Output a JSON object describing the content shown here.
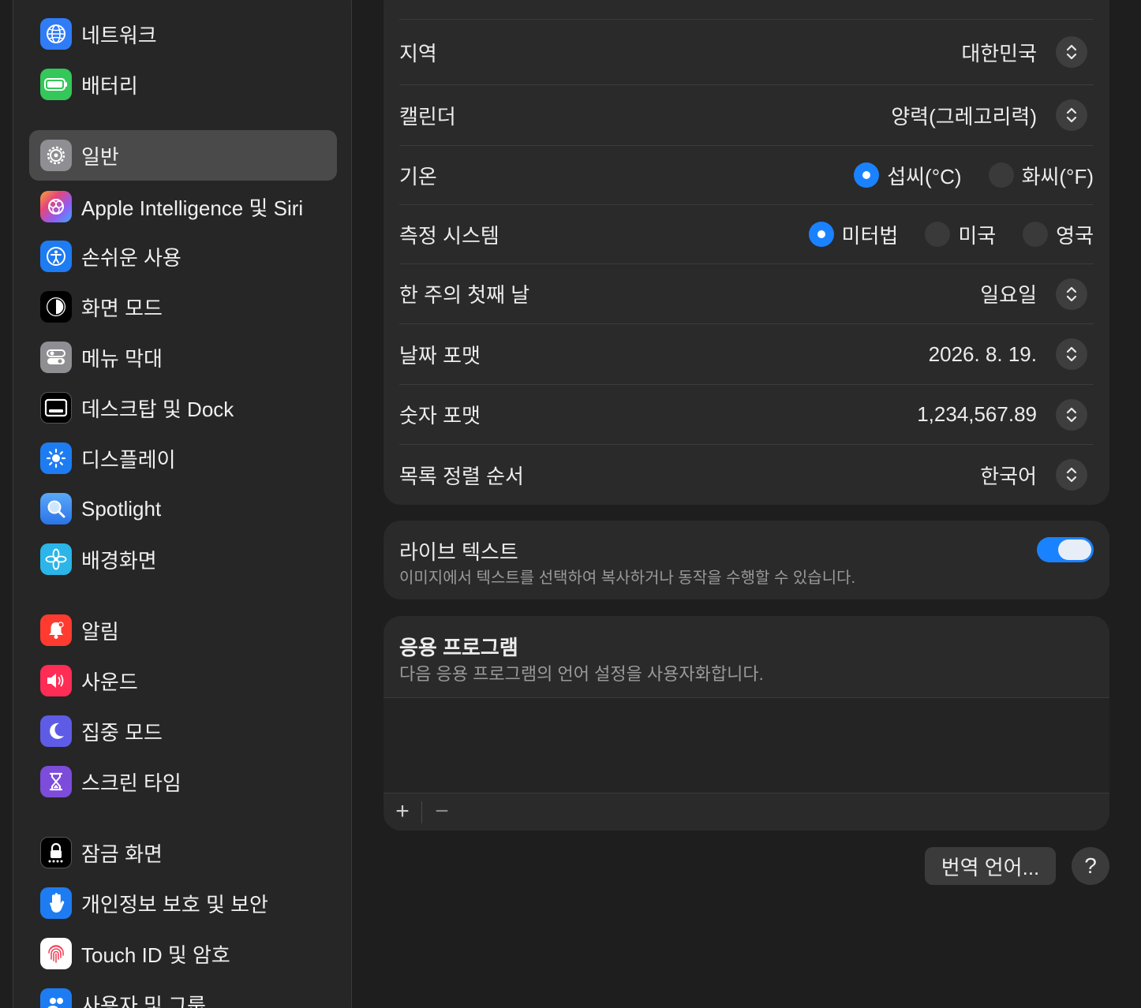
{
  "sidebar": {
    "items": [
      {
        "label": "네트워크",
        "icon": "globe-icon",
        "color": "#2f7cf6"
      },
      {
        "label": "배터리",
        "icon": "battery-icon",
        "color": "#34c759"
      },
      {
        "label": "일반",
        "icon": "gear-icon",
        "color": "#8e8e93"
      },
      {
        "label": "Apple Intelligence 및 Siri",
        "icon": "siri-icon",
        "color": "#e5467a"
      },
      {
        "label": "손쉬운 사용",
        "icon": "accessibility-icon",
        "color": "#1e7cf2"
      },
      {
        "label": "화면 모드",
        "icon": "appearance-icon",
        "color": "#000000"
      },
      {
        "label": "메뉴 막대",
        "icon": "toggles-icon",
        "color": "#8e8e93"
      },
      {
        "label": "데스크탑 및 Dock",
        "icon": "dock-icon",
        "color": "#000000"
      },
      {
        "label": "디스플레이",
        "icon": "sun-icon",
        "color": "#1e7cf2"
      },
      {
        "label": "Spotlight",
        "icon": "magnifier-icon",
        "color": "#3a8cf5"
      },
      {
        "label": "배경화면",
        "icon": "flower-icon",
        "color": "#2bb5e8"
      },
      {
        "label": "알림",
        "icon": "bell-icon",
        "color": "#ff3b30"
      },
      {
        "label": "사운드",
        "icon": "speaker-icon",
        "color": "#ff2d55"
      },
      {
        "label": "집중 모드",
        "icon": "moon-icon",
        "color": "#5e5ce6"
      },
      {
        "label": "스크린 타임",
        "icon": "hourglass-icon",
        "color": "#7d4cdb"
      },
      {
        "label": "잠금 화면",
        "icon": "lock-icon",
        "color": "#000000"
      },
      {
        "label": "개인정보 보호 및 보안",
        "icon": "hand-icon",
        "color": "#1e7cf2"
      },
      {
        "label": "Touch ID 및 암호",
        "icon": "fingerprint-icon",
        "color": "#ffffff"
      },
      {
        "label": "사용자 및 그룹",
        "icon": "users-icon",
        "color": "#1e7cf2"
      }
    ]
  },
  "region": {
    "rows": [
      {
        "label": "지역",
        "value": "대한민국"
      },
      {
        "label": "캘린더",
        "value": "양력(그레고리력)"
      },
      {
        "label": "한 주의 첫째 날",
        "value": "일요일"
      },
      {
        "label": "날짜 포맷",
        "value": "2026. 8. 19."
      },
      {
        "label": "숫자 포맷",
        "value": "1,234,567.89"
      },
      {
        "label": "목록 정렬 순서",
        "value": "한국어"
      }
    ],
    "temperature": {
      "label": "기온",
      "options": [
        "섭씨(°C)",
        "화씨(°F)"
      ],
      "selected": 0
    },
    "measurement": {
      "label": "측정 시스템",
      "options": [
        "미터법",
        "미국",
        "영국"
      ],
      "selected": 0
    }
  },
  "live_text": {
    "title": "라이브 텍스트",
    "description": "이미지에서 텍스트를 선택하여 복사하거나 동작을 수행할 수 있습니다.",
    "enabled": true
  },
  "applications": {
    "title": "응용 프로그램",
    "description": "다음 응용 프로그램의 언어 설정을 사용자화합니다.",
    "add": "+",
    "remove": "−"
  },
  "footer": {
    "translate_button": "번역 언어...",
    "help_button": "?"
  },
  "colors": {
    "accent": "#1a82ff",
    "card": "#2a2a2a",
    "background": "#1e1e1e"
  }
}
